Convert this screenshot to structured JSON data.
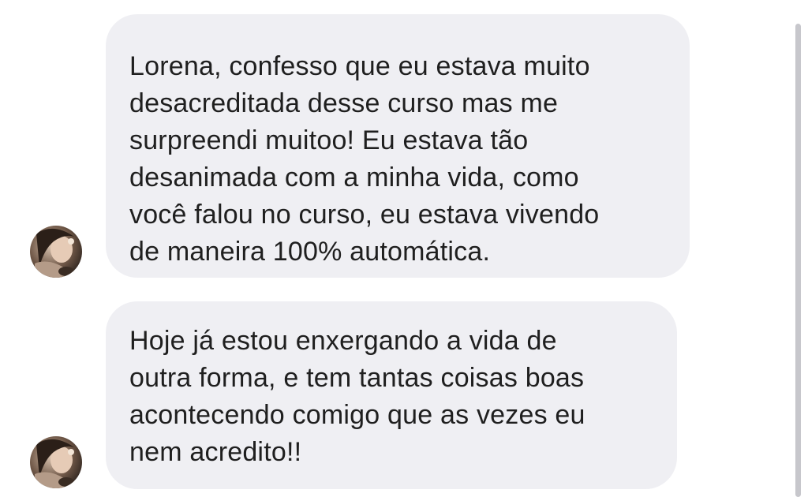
{
  "messages": [
    {
      "sender_avatar": "profile-photo",
      "lines": [
        "Lorena, confesso que eu estava muito",
        "desacreditada desse curso mas me",
        "surpreendi muitoo! Eu estava tão",
        "desanimada com a minha vida, como",
        "você falou no curso, eu estava vivendo",
        "de maneira 100% automática."
      ]
    },
    {
      "sender_avatar": "profile-photo",
      "lines": [
        "Hoje já estou enxergando a vida de",
        "outra forma, e tem tantas coisas boas",
        "acontecendo comigo que as vezes eu",
        "nem acredito!!"
      ]
    }
  ],
  "colors": {
    "bubble_background": "#efeff3",
    "text": "#1f1f1f",
    "scrollbar": "#c7c7cc"
  }
}
